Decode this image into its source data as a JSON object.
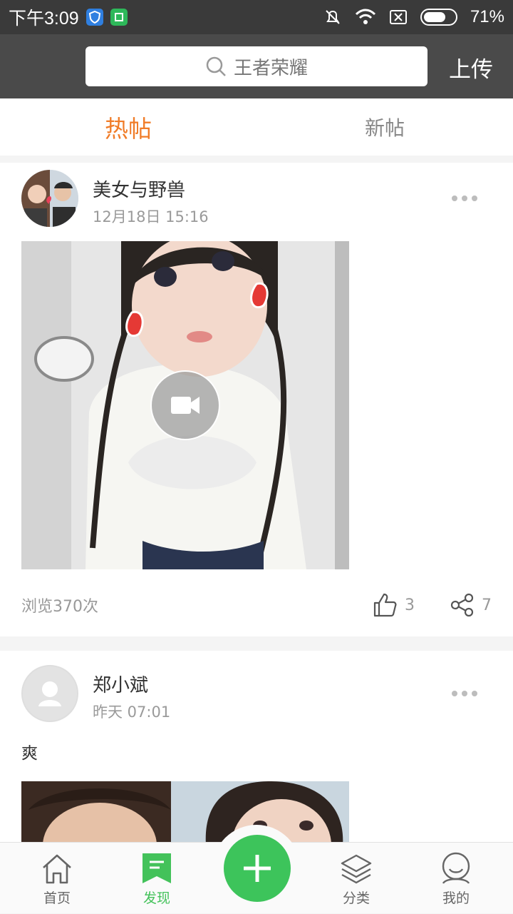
{
  "status_bar": {
    "time": "下午3:09",
    "battery": "71%",
    "battery_level": 0.71
  },
  "header": {
    "search_placeholder": "王者荣耀",
    "upload_label": "上传"
  },
  "tabs": [
    {
      "label": "热帖",
      "active": true
    },
    {
      "label": "新帖",
      "active": false
    }
  ],
  "posts": [
    {
      "username": "美女与野兽",
      "time": "12月18日 15:16",
      "text": "",
      "views": "浏览370次",
      "likes": "3",
      "shares": "7"
    },
    {
      "username": "郑小斌",
      "time": "昨天 07:01",
      "text": "爽"
    }
  ],
  "bottom_nav": [
    {
      "label": "首页",
      "icon": "home-icon"
    },
    {
      "label": "发现",
      "icon": "discover-icon",
      "active": true
    },
    {
      "label": "",
      "icon": "plus-icon"
    },
    {
      "label": "分类",
      "icon": "layers-icon"
    },
    {
      "label": "我的",
      "icon": "user-icon"
    }
  ],
  "colors": {
    "accent_orange": "#f07c28",
    "accent_green": "#43c25a",
    "header_bg": "#4a4a4a",
    "status_bg": "#3a3a3a"
  }
}
